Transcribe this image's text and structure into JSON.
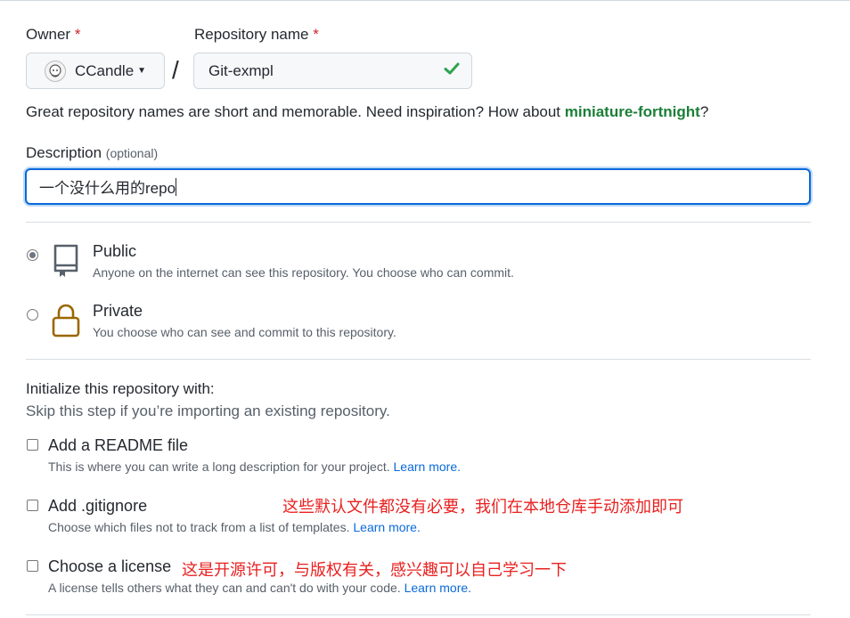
{
  "owner": {
    "label": "Owner",
    "required_mark": "*",
    "value": "CCandle"
  },
  "repository": {
    "label": "Repository name",
    "required_mark": "*",
    "separator": "/",
    "value": "Git-exmpl"
  },
  "name_hint": {
    "text": "Great repository names are short and memorable. Need inspiration? How about ",
    "suggestion": "miniature-fortnight",
    "suffix": "?"
  },
  "description": {
    "label": "Description",
    "optional": "(optional)",
    "value": "一个没什么用的repo"
  },
  "visibility": {
    "public": {
      "title": "Public",
      "subtitle": "Anyone on the internet can see this repository. You choose who can commit.",
      "selected": true
    },
    "private": {
      "title": "Private",
      "subtitle": "You choose who can see and commit to this repository.",
      "selected": false
    }
  },
  "initialize": {
    "title": "Initialize this repository with:",
    "subtitle": "Skip this step if you’re importing an existing repository.",
    "options": [
      {
        "label": "Add a README file",
        "description": "This is where you can write a long description for your project.",
        "link": "Learn more."
      },
      {
        "label": "Add .gitignore",
        "description": "Choose which files not to track from a list of templates.",
        "link": "Learn more."
      },
      {
        "label": "Choose a license",
        "description": "A license tells others what they can and can't do with your code.",
        "link": "Learn more."
      }
    ]
  },
  "annotations": {
    "gitignore_note": "这些默认文件都没有必要，我们在本地仓库手动添加即可",
    "license_note": "这是开源许可，与版权有关，感兴趣可以自己学习一下"
  },
  "icons": {
    "owner_avatar": "octocat-avatar-icon",
    "repo_valid": "check-icon",
    "public": "repo-book-icon",
    "private": "lock-icon"
  },
  "colors": {
    "suggestion_green": "#1a7f37",
    "link_blue": "#0969da",
    "focus_blue": "#0969da",
    "lock_brown": "#9a6700",
    "annotation_red": "#e8201f"
  }
}
